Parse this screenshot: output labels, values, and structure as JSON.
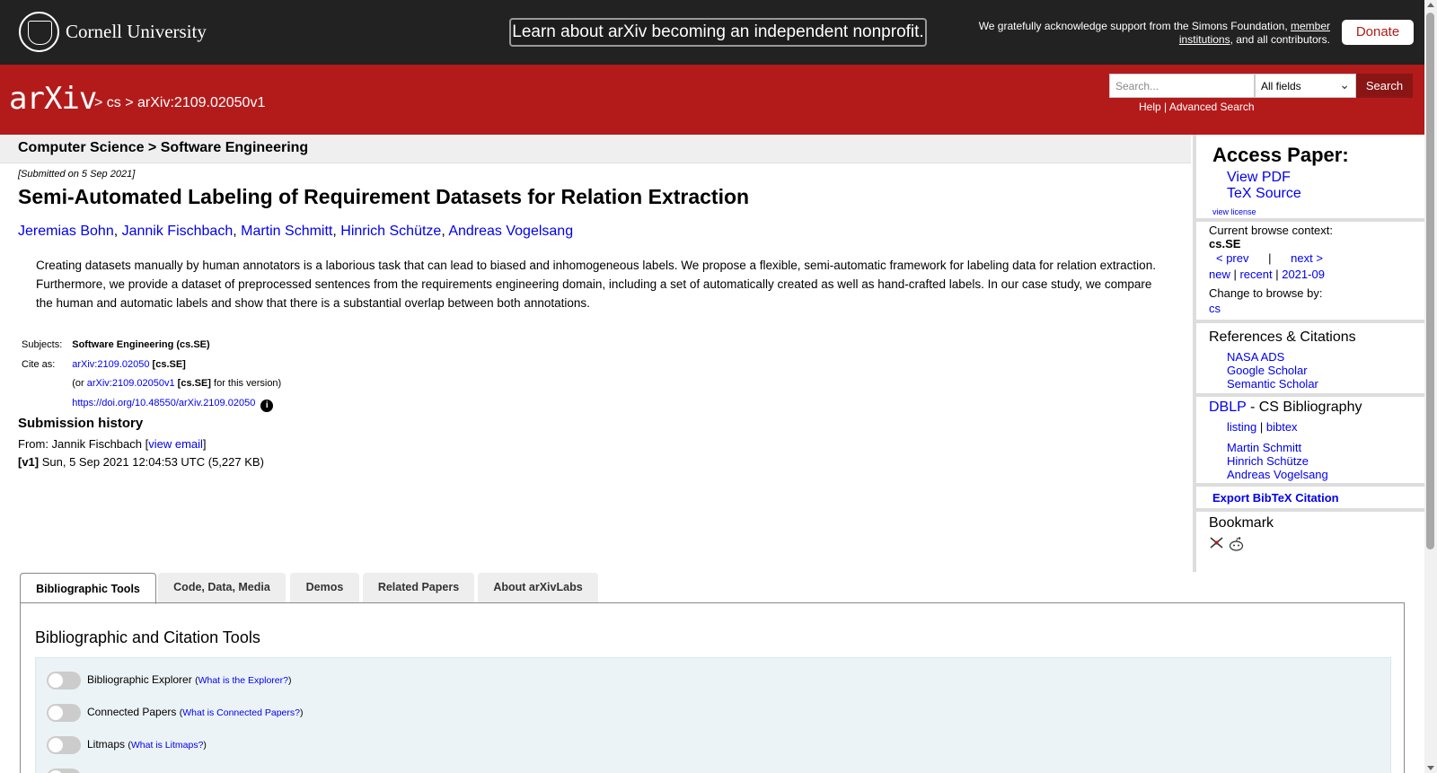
{
  "topbar": {
    "university": "Cornell University",
    "banner": "Learn about arXiv becoming an independent nonprofit.",
    "ack_text": "We gratefully acknowledge support from the Simons Foundation, ",
    "ack_link": "member institutions",
    "ack_tail": ", and all contributors.",
    "donate": "Donate"
  },
  "header": {
    "logo": "arXiv",
    "breadcrumb": "> cs > arXiv:2109.02050v1",
    "search_placeholder": "Search...",
    "field_select": "All fields",
    "search_button": "Search",
    "help": "Help",
    "advanced_search": "Advanced Search"
  },
  "paper": {
    "subject_header": "Computer Science > Software Engineering",
    "submitted": "[Submitted on 5 Sep 2021]",
    "title": "Semi-Automated Labeling of Requirement Datasets for Relation Extraction",
    "authors": [
      "Jeremias Bohn",
      "Jannik Fischbach",
      "Martin Schmitt",
      "Hinrich Schütze",
      "Andreas Vogelsang"
    ],
    "abstract": "Creating datasets manually by human annotators is a laborious task that can lead to biased and inhomogeneous labels. We propose a flexible, semi-automatic framework for labeling data for relation extraction. Furthermore, we provide a dataset of preprocessed sentences from the requirements engineering domain, including a set of automatically created as well as hand-crafted labels. In our case study, we compare the human and automatic labels and show that there is a substantial overlap between both annotations.",
    "subjects_label": "Subjects:",
    "subjects_value": "Software Engineering (cs.SE)",
    "cite_label": "Cite as:",
    "cite_id": "arXiv:2109.02050",
    "cite_tag": "[cs.SE]",
    "cite_version_prefix": "(or ",
    "cite_version_id": "arXiv:2109.02050v1",
    "cite_version_tag": "[cs.SE]",
    "cite_version_suffix": " for this version)",
    "doi": "https://doi.org/10.48550/arXiv.2109.02050",
    "history_title": "Submission history",
    "from_prefix": "From: Jannik Fischbach [",
    "view_email": "view email",
    "from_suffix": "]",
    "v1_label": "[v1]",
    "v1_detail": " Sun, 5 Sep 2021 12:04:53 UTC (5,227 KB)"
  },
  "sidebar": {
    "access_title": "Access Paper:",
    "view_pdf": "View PDF",
    "tex_source": "TeX Source",
    "view_license": "view license",
    "browse_context_label": "Current browse context:",
    "browse_context": "cs.SE",
    "prev": "< prev",
    "pipe": "|",
    "next": "next >",
    "new": "new",
    "recent": "recent",
    "date": "2021-09",
    "change_browse": "Change to browse by:",
    "cs": "cs",
    "refs_title": "References & Citations",
    "nasa": "NASA ADS",
    "google": "Google Scholar",
    "semantic": "Semantic Scholar",
    "dblp": "DBLP",
    "dblp_tail": " - CS Bibliography",
    "listing": "listing",
    "bibtex": "bibtex",
    "dblp_authors": [
      "Martin Schmitt",
      "Hinrich Schütze",
      "Andreas Vogelsang"
    ],
    "export_bibtex": "Export BibTeX Citation",
    "bookmark_title": "Bookmark"
  },
  "tabs": [
    "Bibliographic Tools",
    "Code, Data, Media",
    "Demos",
    "Related Papers",
    "About arXivLabs"
  ],
  "tools": {
    "title": "Bibliographic and Citation Tools",
    "items": [
      {
        "label": "Bibliographic Explorer",
        "help": "What is the Explorer?"
      },
      {
        "label": "Connected Papers",
        "help": "What is Connected Papers?"
      },
      {
        "label": "Litmaps",
        "help": "What is Litmaps?"
      }
    ]
  }
}
